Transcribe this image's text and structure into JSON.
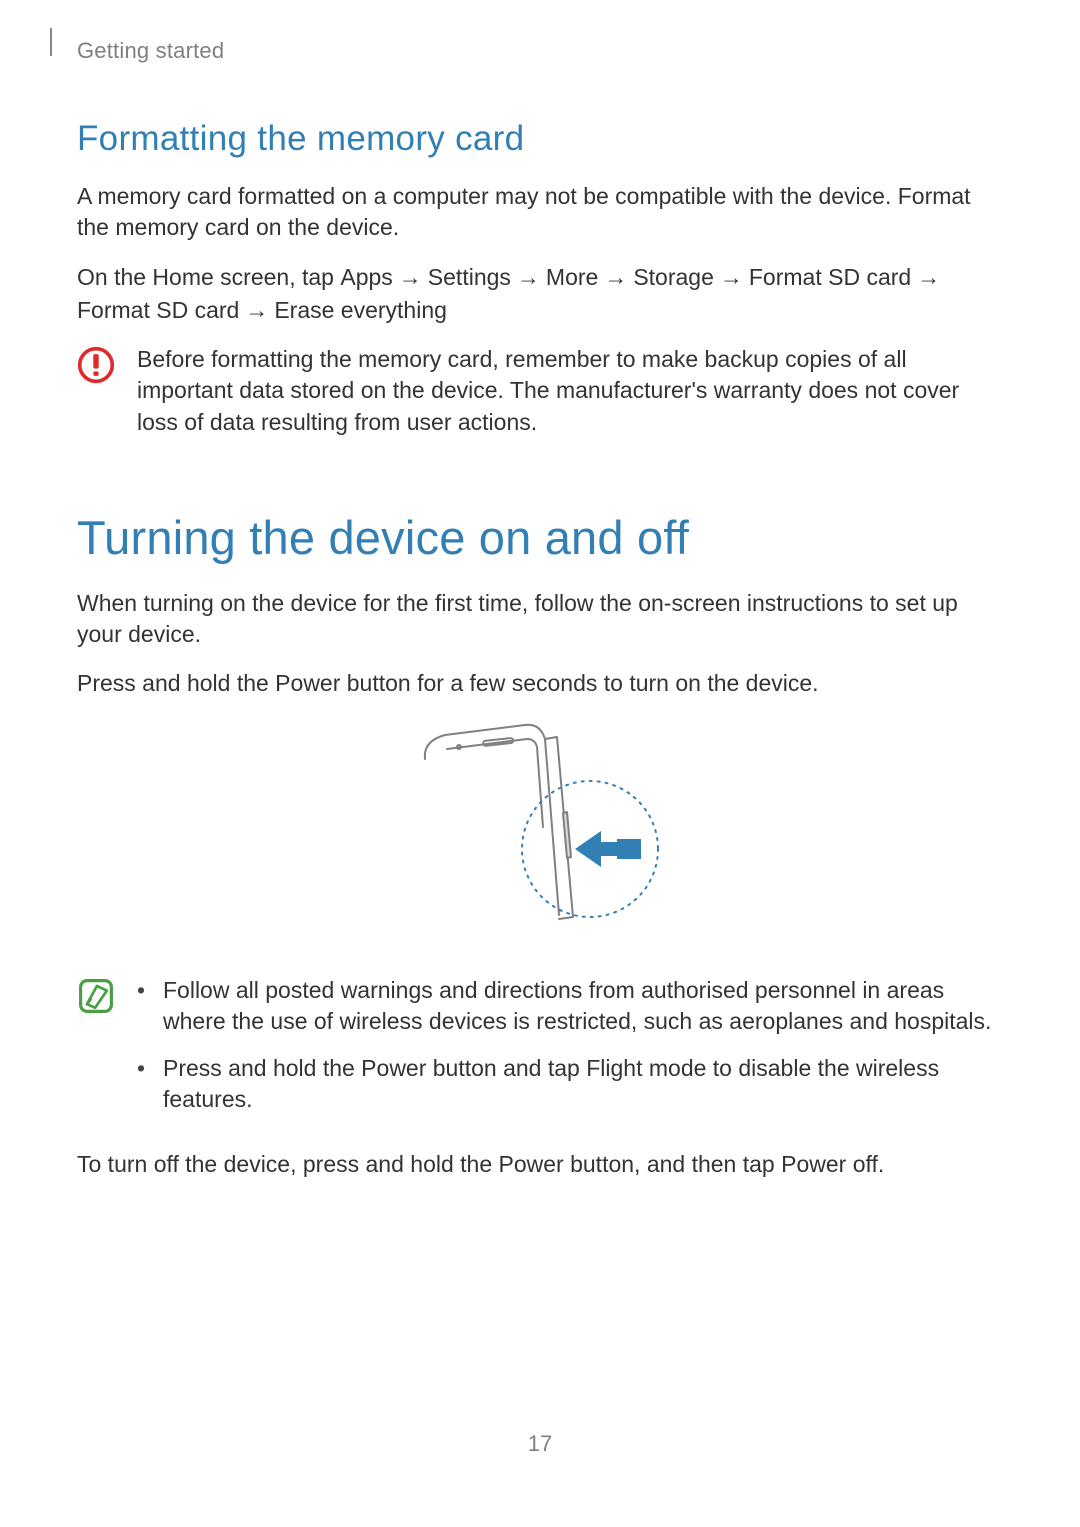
{
  "breadcrumb": "Getting started",
  "h2": "Formatting the memory card",
  "para1": "A memory card formatted on a computer may not be compatible with the device. Format the memory card on the device.",
  "steps": {
    "lead": "On the Home screen, tap ",
    "seq": [
      "Apps",
      "Settings",
      "More",
      "Storage",
      "Format SD card",
      "Format SD card",
      "Erase everything"
    ]
  },
  "warn": "Before formatting the memory card, remember to make backup copies of all important data stored on the device. The manufacturer's warranty does not cover loss of data resulting from user actions.",
  "h1": "Turning the device on and off",
  "para2": "When turning on the device for the first time, follow the on-screen instructions to set up your device.",
  "para3": "Press and hold the Power button for a few seconds to turn on the device.",
  "note_items": [
    "Follow all posted warnings and directions from authorised personnel in areas where the use of wireless devices is restricted, such as aeroplanes and hospitals.",
    {
      "pre": "Press and hold the Power button and tap ",
      "mid": "Flight mode",
      "post": " to disable the wireless features."
    }
  ],
  "para4": {
    "pre": "To turn off the device, press and hold the Power button, and then tap ",
    "mid": "Power off",
    "post": "."
  },
  "page_number": "17"
}
